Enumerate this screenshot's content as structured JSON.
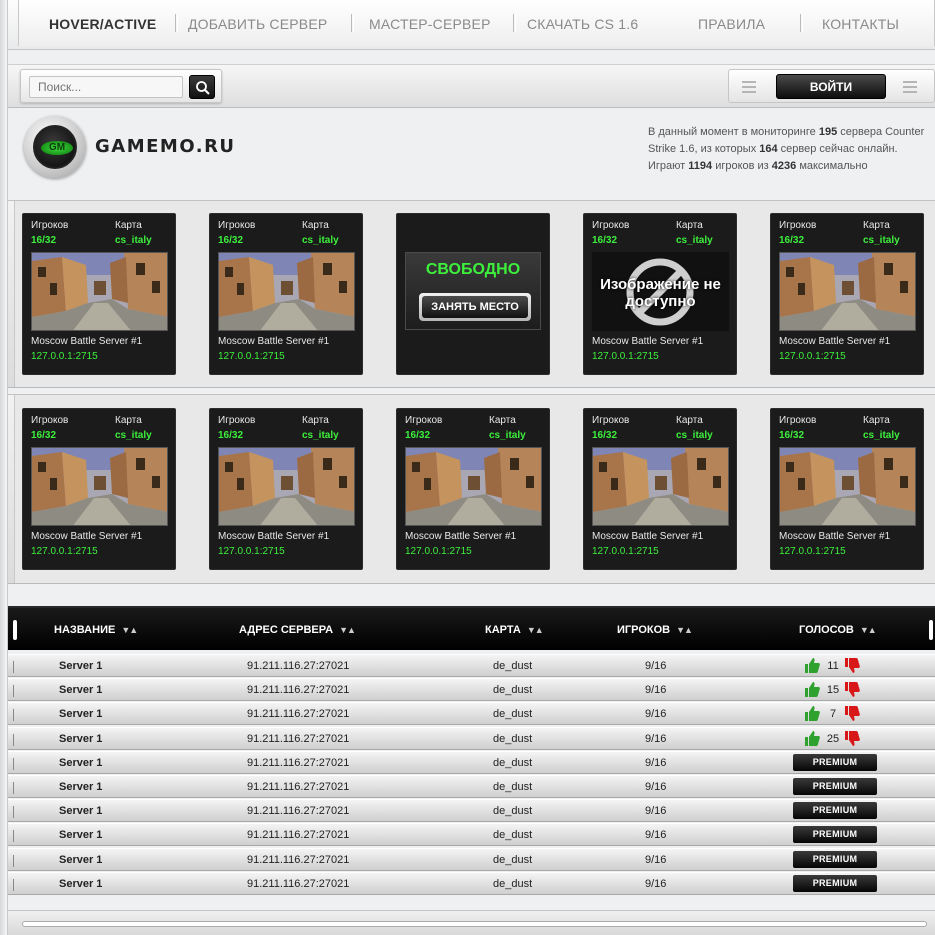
{
  "nav": {
    "items": [
      {
        "label": "HOVER/ACTIVE",
        "active": true
      },
      {
        "label": "ДОБАВИТЬ СЕРВЕР",
        "active": false
      },
      {
        "label": "МАСТЕР-СЕРВЕР",
        "active": false
      },
      {
        "label": "СКАЧАТЬ CS 1.6",
        "active": false
      },
      {
        "label": "ПРАВИЛА",
        "active": false
      },
      {
        "label": "КОНТАКТЫ",
        "active": false
      }
    ]
  },
  "search": {
    "placeholder": "Поиск...",
    "icon": "search-icon"
  },
  "login": {
    "label": "ВОЙТИ"
  },
  "header": {
    "logo_badge": "GM",
    "site_name": "GAMEMO.RU",
    "stats": {
      "p1": "В данный момент в мониторинге",
      "servers_total": "195",
      "p2": "сервера Counter Strike 1.6, из которых",
      "servers_online": "164",
      "p3": "сервер сейчас онлайн.",
      "p4": "Играют",
      "players": "1194",
      "p5": "игроков из",
      "max_players": "4236",
      "p6": "максимально"
    }
  },
  "cards": {
    "players_label": "Игроков",
    "map_label": "Карта",
    "players_value": "16/32",
    "map_value": "cs_italy",
    "server_name": "Moscow Battle Server #1",
    "server_ip": "127.0.0.1:2715",
    "free_title": "СВОБОДНО",
    "free_button": "ЗАНЯТЬ МЕСТО",
    "no_image_text": "Изображение не доступно"
  },
  "table": {
    "columns": [
      {
        "label": "НАЗВАНИЕ",
        "sort": "▼▲"
      },
      {
        "label": "АДРЕС СЕРВЕРА",
        "sort": "▼▲"
      },
      {
        "label": "КАРТА",
        "sort": "▼▲"
      },
      {
        "label": "ИГРОКОВ",
        "sort": "▼▲"
      },
      {
        "label": "ГОЛОСОВ",
        "sort": "▼▲"
      }
    ],
    "premium_label": "PREMIUM",
    "rows": [
      {
        "name": "Server 1",
        "address": "91.211.116.27:27021",
        "map": "de_dust",
        "players": "9/16",
        "votes": "11"
      },
      {
        "name": "Server 1",
        "address": "91.211.116.27:27021",
        "map": "de_dust",
        "players": "9/16",
        "votes": "15"
      },
      {
        "name": "Server 1",
        "address": "91.211.116.27:27021",
        "map": "de_dust",
        "players": "9/16",
        "votes": "7"
      },
      {
        "name": "Server 1",
        "address": "91.211.116.27:27021",
        "map": "de_dust",
        "players": "9/16",
        "votes": "25"
      },
      {
        "name": "Server 1",
        "address": "91.211.116.27:27021",
        "map": "de_dust",
        "players": "9/16",
        "votes": null
      },
      {
        "name": "Server 1",
        "address": "91.211.116.27:27021",
        "map": "de_dust",
        "players": "9/16",
        "votes": null
      },
      {
        "name": "Server 1",
        "address": "91.211.116.27:27021",
        "map": "de_dust",
        "players": "9/16",
        "votes": null
      },
      {
        "name": "Server 1",
        "address": "91.211.116.27:27021",
        "map": "de_dust",
        "players": "9/16",
        "votes": null
      },
      {
        "name": "Server 1",
        "address": "91.211.116.27:27021",
        "map": "de_dust",
        "players": "9/16",
        "votes": null
      },
      {
        "name": "Server 1",
        "address": "91.211.116.27:27021",
        "map": "de_dust",
        "players": "9/16",
        "votes": null
      }
    ]
  },
  "colors": {
    "accent_green": "#3cf03c",
    "vote_up": "#2fa12f",
    "vote_down": "#d81818",
    "dark": "#1b1b1b"
  }
}
